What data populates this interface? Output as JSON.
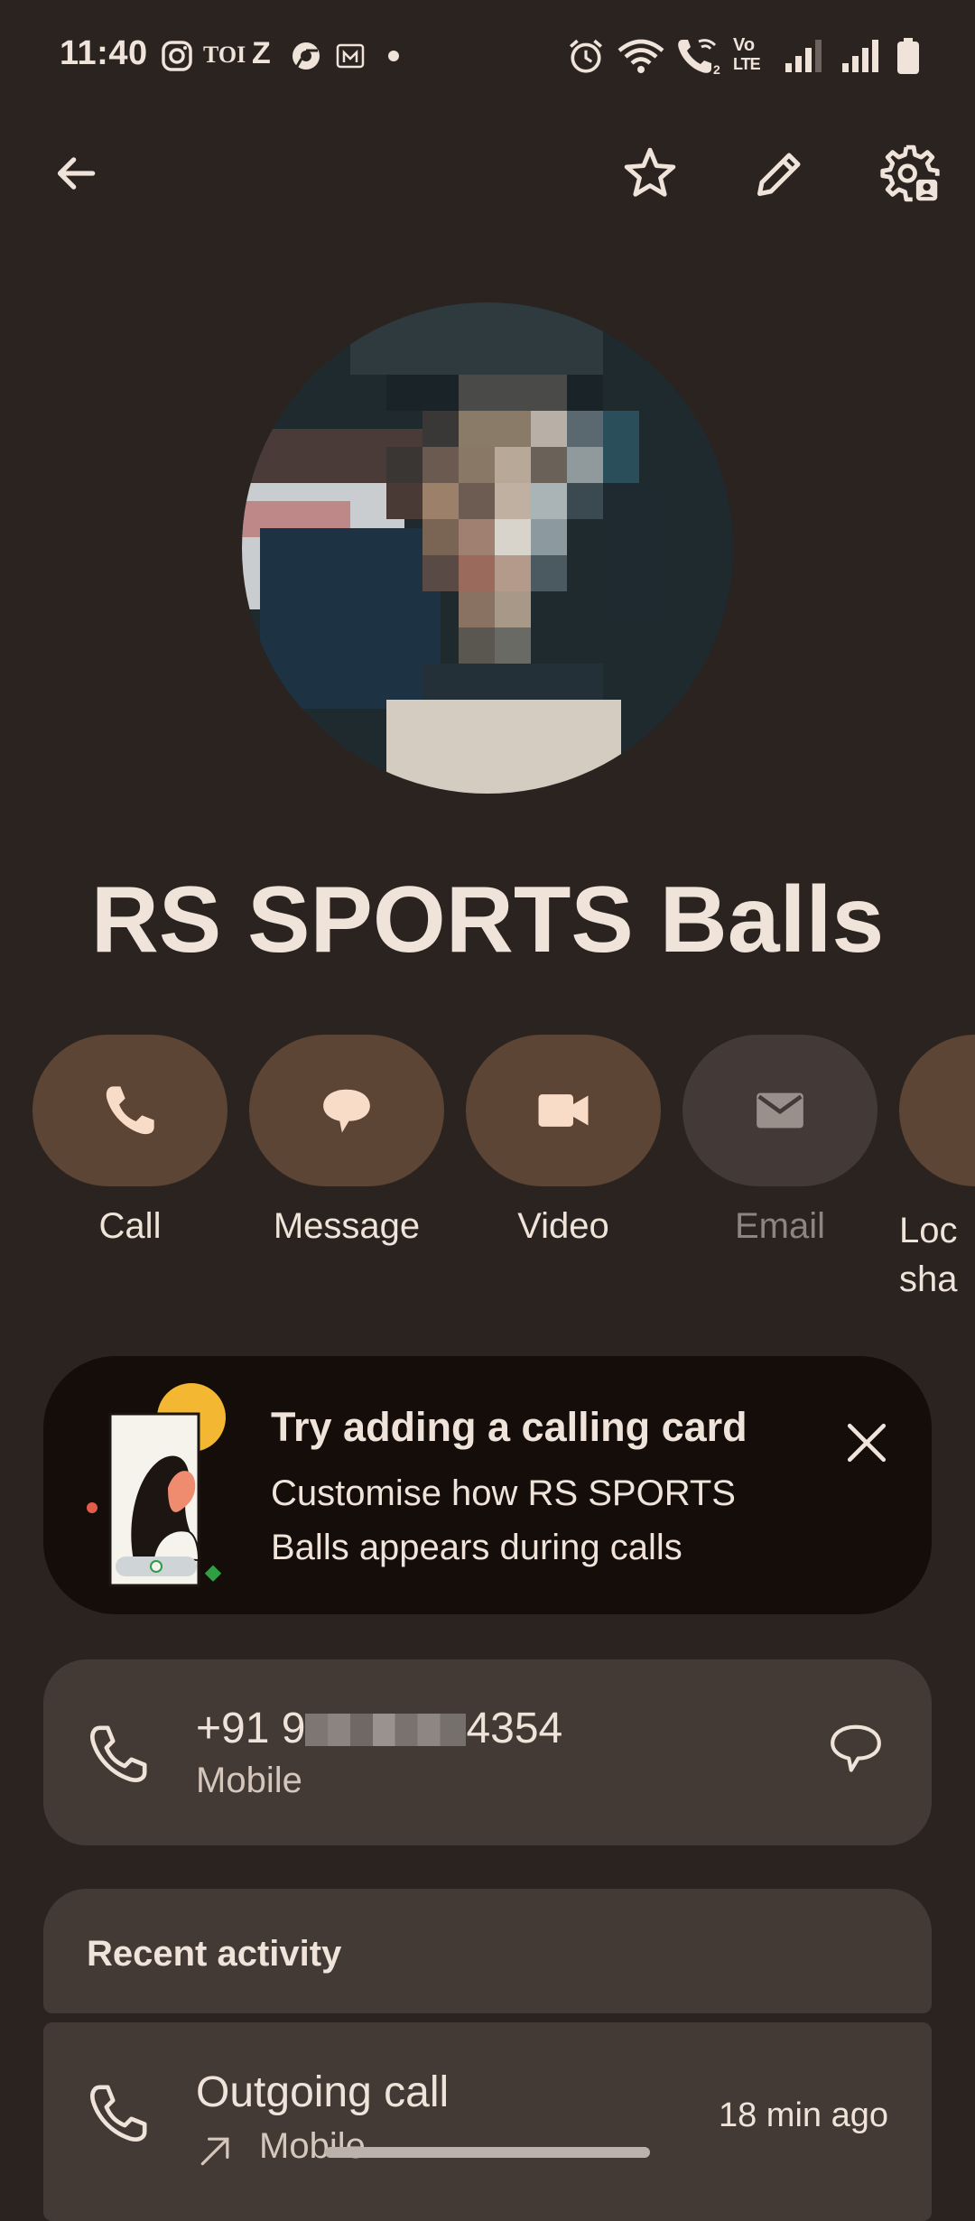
{
  "status_bar": {
    "time": "11:40",
    "notif_toi": "TOI",
    "notif_z": "Z",
    "volte_top": "Vo",
    "volte_bottom": "LTE",
    "icons": [
      "instagram-icon",
      "toi-icon",
      "zee-icon",
      "chrome-icon",
      "m-app-icon",
      "dot-icon",
      "alarm-icon",
      "wifi-icon",
      "wifi-call-icon",
      "volte-icon",
      "signal-1-icon",
      "signal-2-icon",
      "battery-icon"
    ]
  },
  "top_bar": {
    "icons": [
      "back-arrow-icon",
      "star-icon",
      "edit-pencil-icon",
      "contact-settings-icon"
    ]
  },
  "contact": {
    "name": "RS SPORTS Balls"
  },
  "actions": [
    {
      "label": "Call",
      "icon": "phone-icon",
      "enabled": true
    },
    {
      "label": "Message",
      "icon": "message-icon",
      "enabled": true
    },
    {
      "label": "Video",
      "icon": "video-icon",
      "enabled": true
    },
    {
      "label": "Email",
      "icon": "email-icon",
      "enabled": false
    },
    {
      "label": "Loc sha",
      "icon": "location-share-icon",
      "enabled": true
    }
  ],
  "calling_card": {
    "title": "Try adding a calling card",
    "subtitle": "Customise how RS SPORTS Balls appears during calls"
  },
  "phone": {
    "number_prefix": "+91 9",
    "number_suffix": "4354",
    "type": "Mobile"
  },
  "recent_activity": {
    "heading": "Recent activity",
    "items": [
      {
        "title": "Outgoing call",
        "sub": "Mobile",
        "time": "18 min ago"
      }
    ]
  },
  "colors": {
    "background": "#2a2320",
    "accent_pill": "#5c4535",
    "card_dark": "#140d0a",
    "surface": "#433a35",
    "text": "#efe3da"
  }
}
